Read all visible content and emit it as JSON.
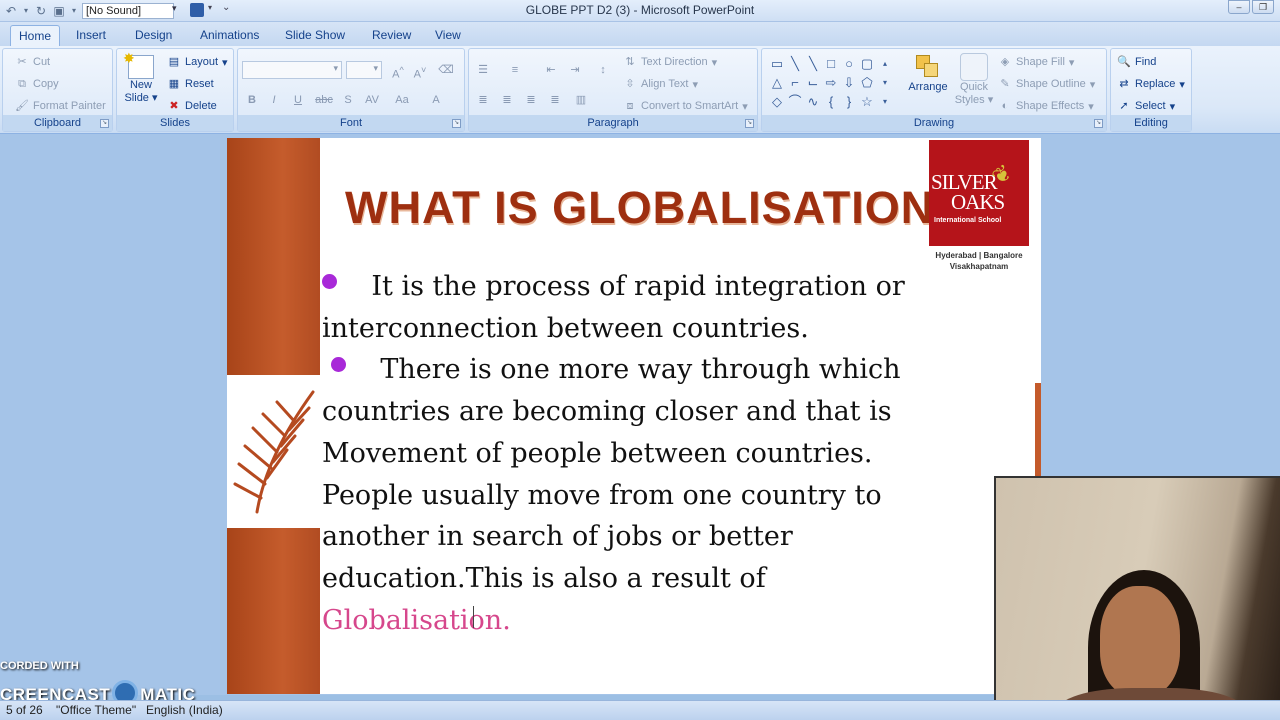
{
  "window": {
    "title": "GLOBE PPT D2 (3) - Microsoft PowerPoint",
    "sound_value": "[No Sound]"
  },
  "tabs": [
    "Home",
    "Insert",
    "Design",
    "Animations",
    "Slide Show",
    "Review",
    "View"
  ],
  "ribbon": {
    "clipboard": {
      "label": "Clipboard",
      "cut": "Cut",
      "copy": "Copy",
      "format_painter": "Format Painter"
    },
    "slides": {
      "label": "Slides",
      "new_slide": "New",
      "new_slide2": "Slide",
      "layout": "Layout",
      "reset": "Reset",
      "delete": "Delete"
    },
    "font": {
      "label": "Font"
    },
    "paragraph": {
      "label": "Paragraph",
      "text_direction": "Text Direction",
      "align_text": "Align Text",
      "convert_smartart": "Convert to SmartArt"
    },
    "drawing": {
      "label": "Drawing",
      "arrange": "Arrange",
      "quick_styles": "Quick",
      "quick_styles2": "Styles",
      "shape_fill": "Shape Fill",
      "shape_outline": "Shape Outline",
      "shape_effects": "Shape Effects"
    },
    "editing": {
      "label": "Editing",
      "find": "Find",
      "replace": "Replace",
      "select": "Select"
    }
  },
  "slide": {
    "title": "WHAT IS GLOBALISATION",
    "logo": {
      "line1": "SILVER",
      "line2": "OAKS",
      "line3": "International School",
      "cities1": "Hyderabad | Bangalore",
      "cities2": "Visakhapatnam"
    },
    "bullet1": "It is the process of rapid integration or interconnection between countries.",
    "bullet2": "There is one more way through which countries are becoming closer and that is Movement of people between countries. People usually move from one country to another in search of jobs or better education.This is also a result of",
    "highlight": "Globalisation.",
    "bullet_color": "#a829d8",
    "highlight_color": "#d6478c"
  },
  "status": {
    "slide_count": "5 of 26",
    "theme": "\"Office Theme\"",
    "language": "English (India)"
  },
  "watermark": {
    "line1": "CORDED WITH",
    "line2a": "CREENCAST",
    "line2b": "MATIC"
  }
}
